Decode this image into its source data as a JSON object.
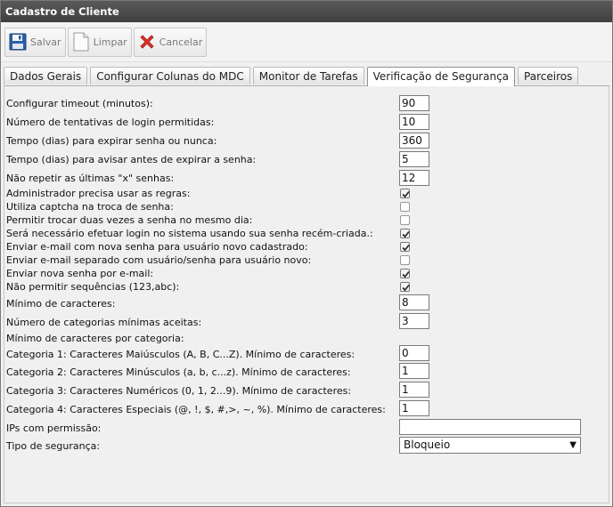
{
  "window": {
    "title": "Cadastro de Cliente"
  },
  "toolbar": {
    "save_label": "Salvar",
    "clear_label": "Limpar",
    "cancel_label": "Cancelar",
    "save_icon": "floppy-disk-icon",
    "clear_icon": "blank-document-icon",
    "cancel_icon": "red-x-icon"
  },
  "tabs": [
    {
      "label": "Dados Gerais",
      "active": false
    },
    {
      "label": "Configurar Colunas do MDC",
      "active": false
    },
    {
      "label": "Monitor de Tarefas",
      "active": false
    },
    {
      "label": "Verificação de Segurança",
      "active": true
    },
    {
      "label": "Parceiros",
      "active": false
    }
  ],
  "form": {
    "timeout": {
      "label": "Configurar timeout (minutos):",
      "value": "90"
    },
    "login_attempts": {
      "label": "Número de tentativas de login permitidas:",
      "value": "10"
    },
    "password_expire_days": {
      "label": "Tempo (dias) para expirar senha ou nunca:",
      "value": "360"
    },
    "password_warn_days": {
      "label": "Tempo (dias) para avisar antes de expirar a senha:",
      "value": "5"
    },
    "no_repeat_last": {
      "label": "Não repetir as últimas \"x\" senhas:",
      "value": "12"
    },
    "checks": [
      {
        "label": "Administrador precisa usar as regras:",
        "checked": true
      },
      {
        "label": "Utiliza captcha na troca de senha:",
        "checked": false
      },
      {
        "label": "Permitir trocar duas vezes a senha no mesmo dia:",
        "checked": false
      },
      {
        "label": "Será necessário efetuar login no sistema usando sua senha recém-criada.:",
        "checked": true
      },
      {
        "label": "Enviar e-mail com nova senha para usuário novo cadastrado:",
        "checked": true
      },
      {
        "label": "Enviar e-mail separado com usuário/senha para usuário novo:",
        "checked": false
      },
      {
        "label": "Enviar nova senha por e-mail:",
        "checked": true
      },
      {
        "label": "Não permitir sequências (123,abc):",
        "checked": true
      }
    ],
    "min_chars": {
      "label": "Mínimo de caracteres:",
      "value": "8"
    },
    "min_categories": {
      "label": "Número de categorias mínimas aceitas:",
      "value": "3"
    },
    "per_category_heading": "Mínimo de caracteres por categoria:",
    "cat1": {
      "label": "Categoria 1: Caracteres Maiúsculos (A, B, C...Z). Mínimo de caracteres:",
      "value": "0"
    },
    "cat2": {
      "label": "Categoria 2: Caracteres Minúsculos (a, b, c...z). Mínimo de caracteres:",
      "value": "1"
    },
    "cat3": {
      "label": "Categoria 3: Caracteres Numéricos (0, 1, 2...9). Mínimo de caracteres:",
      "value": "1"
    },
    "cat4": {
      "label": "Categoria 4: Caracteres Especiais (@, !, $, #,>, ~, %). Mínimo de caracteres:",
      "value": "1"
    },
    "allowed_ips": {
      "label": "IPs com permissão:",
      "value": ""
    },
    "security_type": {
      "label": "Tipo de segurança:",
      "value": "Bloqueio"
    }
  }
}
